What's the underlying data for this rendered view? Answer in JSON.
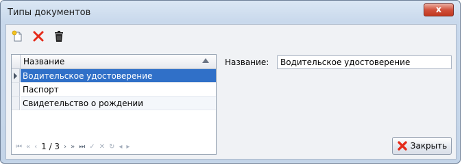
{
  "window": {
    "title": "Типы документов",
    "close_glyph": "x"
  },
  "toolbar": {
    "icons": [
      "new-document-icon",
      "delete-red-x-icon",
      "trash-icon"
    ]
  },
  "grid": {
    "header": "Название",
    "rows": [
      {
        "name": "Водительское удостоверение",
        "selected": true
      },
      {
        "name": "Паспорт",
        "selected": false
      },
      {
        "name": "Свидетельство о рождении",
        "selected": false
      }
    ]
  },
  "navigator": {
    "first": "⏮",
    "prev_page": "«",
    "prev": "‹",
    "page_text": "1 / 3",
    "next": "›",
    "next_page": "»",
    "last": "⏭",
    "confirm": "✓",
    "cancel": "✕",
    "refresh": "↻",
    "scroll_left": "◂",
    "scroll_right": "▸"
  },
  "detail": {
    "name_label": "Название:",
    "name_value": "Водительское удостоверение"
  },
  "actions": {
    "close_label": "Закрыть"
  },
  "colors": {
    "selection": "#3070c8",
    "close_red": "#d1503b",
    "accent_red": "#e52b1a"
  }
}
